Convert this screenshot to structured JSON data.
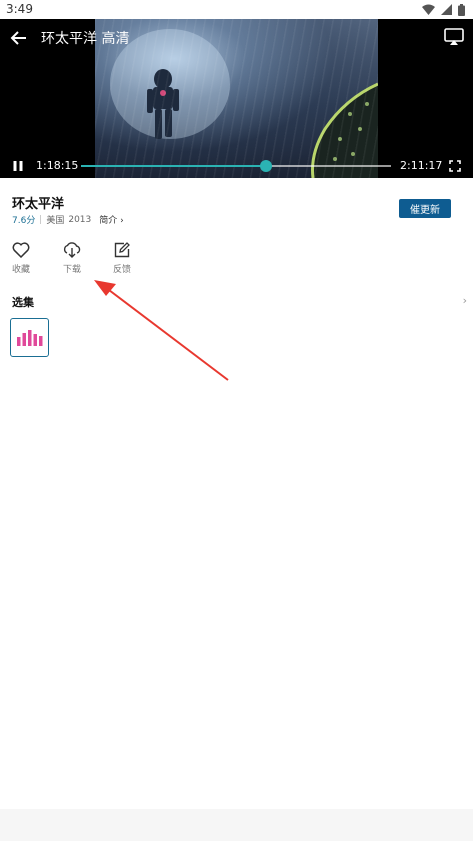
{
  "status_bar": {
    "time": "3:49"
  },
  "player": {
    "title": "环太平洋 高清",
    "current_time": "1:18:15",
    "total_time": "2:11:17",
    "progress": 0.596,
    "accent_color": "#2bb3b3"
  },
  "movie": {
    "title": "环太平洋",
    "score": "7.6分",
    "region": "美国",
    "year": "2013",
    "intro_label": "简介",
    "urge_update_label": "催更新"
  },
  "actions": [
    {
      "icon": "heart-icon",
      "label": "收藏"
    },
    {
      "icon": "download-icon",
      "label": "下载"
    },
    {
      "icon": "feedback-icon",
      "label": "反馈"
    }
  ],
  "episodes": {
    "header": "选集",
    "items": [
      {
        "icon": "playing-equalizer-icon",
        "color": "#e0499a"
      }
    ]
  },
  "colors": {
    "brand": "#0e5c91",
    "annotation_arrow": "#e8382f"
  }
}
